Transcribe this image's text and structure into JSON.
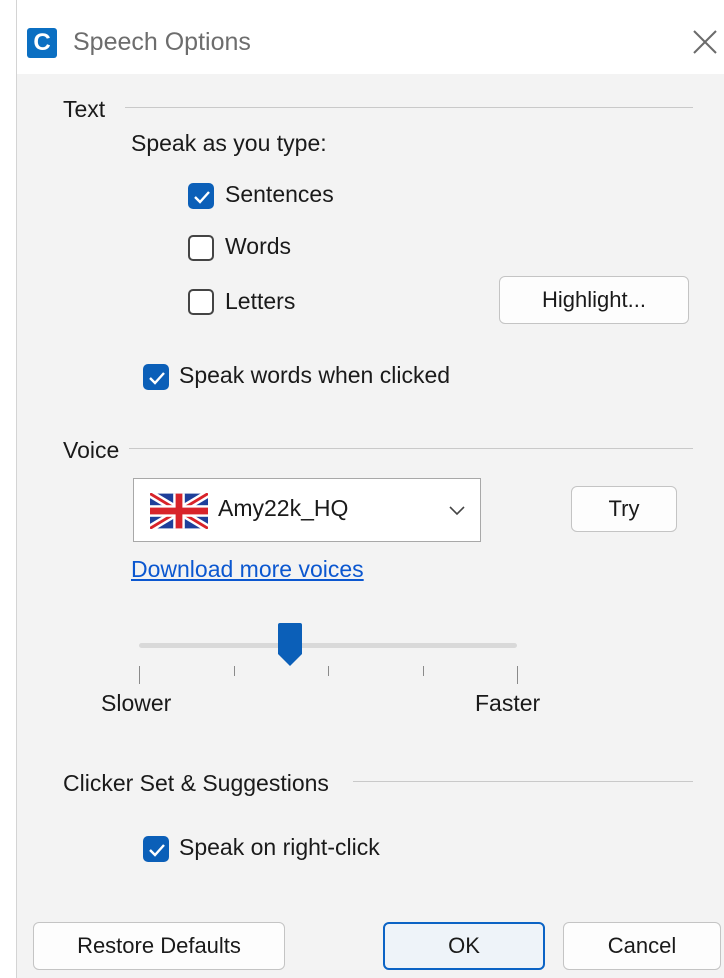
{
  "window": {
    "app_icon_letter": "C",
    "title": "Speech Options",
    "close_icon": "close-icon",
    "accent_color": "#0b5fb8"
  },
  "text_section": {
    "heading": "Text",
    "speak_as_you_type_label": "Speak as you type:",
    "options": [
      {
        "label": "Sentences",
        "checked": true
      },
      {
        "label": "Words",
        "checked": false
      },
      {
        "label": "Letters",
        "checked": false
      }
    ],
    "highlight_button": "Highlight...",
    "speak_words_clicked": {
      "label": "Speak words when clicked",
      "checked": true
    }
  },
  "voice_section": {
    "heading": "Voice",
    "selected_voice": "Amy22k_HQ",
    "voice_flag_icon": "uk-flag-icon",
    "try_button": "Try",
    "download_link": "Download more voices",
    "speed_slider": {
      "min_label": "Slower",
      "max_label": "Faster",
      "tick_count": 5,
      "value_fraction": 0.4
    }
  },
  "clicker_section": {
    "heading": "Clicker Set & Suggestions",
    "speak_right_click": {
      "label": "Speak on right-click",
      "checked": true
    }
  },
  "footer": {
    "restore_defaults": "Restore Defaults",
    "ok": "OK",
    "cancel": "Cancel"
  }
}
